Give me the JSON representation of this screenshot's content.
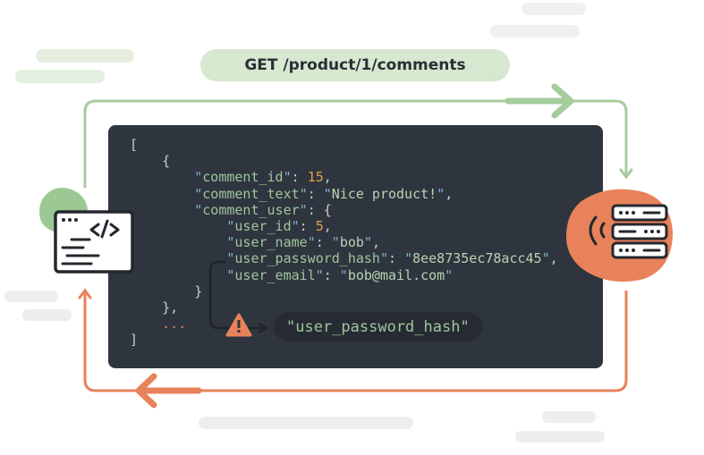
{
  "request": {
    "label": "GET /product/1/comments"
  },
  "response": {
    "lines": [
      {
        "indent": 0,
        "text": "["
      },
      {
        "indent": 1,
        "text": "{"
      },
      {
        "indent": 2,
        "key": "comment_id",
        "value": "15",
        "type": "number",
        "trail": ","
      },
      {
        "indent": 2,
        "key": "comment_text",
        "value": "Nice product!",
        "type": "string",
        "trail": ","
      },
      {
        "indent": 2,
        "key": "comment_user",
        "value": "{",
        "type": "open",
        "trail": ""
      },
      {
        "indent": 3,
        "key": "user_id",
        "value": "5",
        "type": "number",
        "trail": ","
      },
      {
        "indent": 3,
        "key": "user_name",
        "value": "bob",
        "type": "string",
        "trail": ","
      },
      {
        "indent": 3,
        "key": "user_password_hash",
        "value": "8ee8735ec78acc45",
        "type": "string",
        "trail": ","
      },
      {
        "indent": 3,
        "key": "user_email",
        "value": "bob@mail.com",
        "type": "string",
        "trail": ""
      },
      {
        "indent": 2,
        "text": "}"
      },
      {
        "indent": 1,
        "text": "},"
      },
      {
        "indent": 1,
        "text": "...",
        "type": "ellipsis"
      },
      {
        "indent": 0,
        "text": "]"
      }
    ]
  },
  "highlight": {
    "label": "\"user_password_hash\"",
    "icon": "warning-icon"
  },
  "client": {
    "icon": "code-window-icon"
  },
  "server": {
    "icon": "server-icon"
  },
  "colors": {
    "panel": "#2f353f",
    "request_flow": "#a7cc9c",
    "response_flow": "#e8825a",
    "warning": "#e8825a"
  }
}
